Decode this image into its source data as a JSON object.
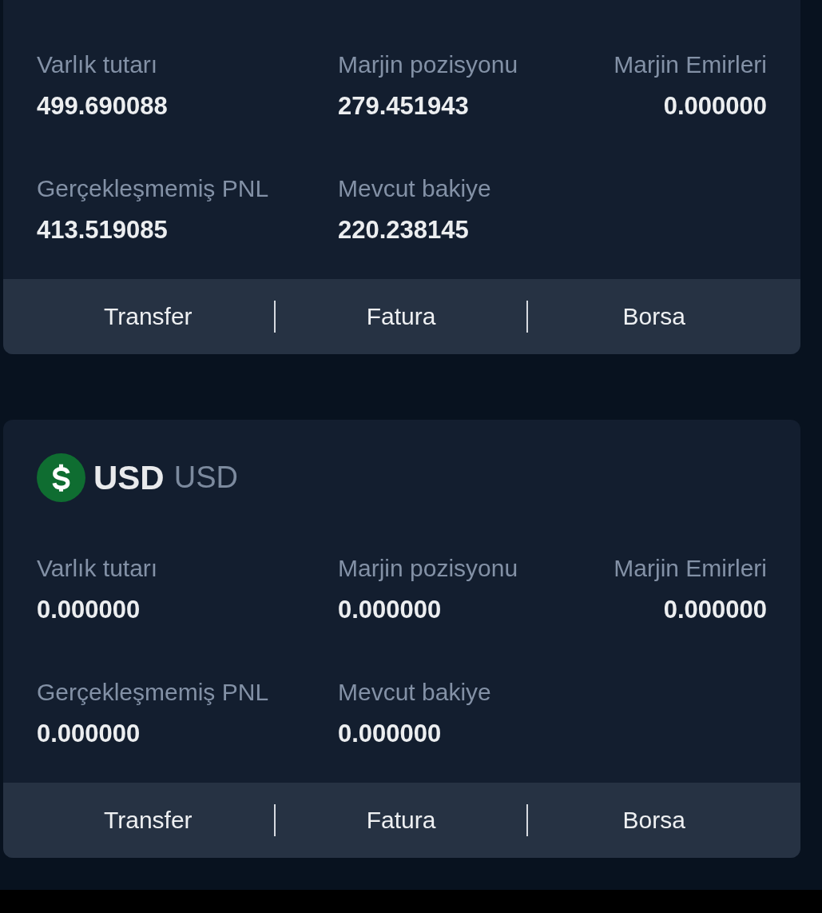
{
  "cards": [
    {
      "fields": [
        {
          "label": "Varlık tutarı",
          "value": "499.690088"
        },
        {
          "label": "Marjin pozisyonu",
          "value": "279.451943"
        },
        {
          "label": "Marjin Emirleri",
          "value": "0.000000"
        },
        {
          "label": "Gerçekleşmemiş PNL",
          "value": "413.519085"
        },
        {
          "label": "Mevcut bakiye",
          "value": "220.238145"
        }
      ],
      "actions": [
        "Transfer",
        "Fatura",
        "Borsa"
      ]
    },
    {
      "header": {
        "title": "USD",
        "subtitle": "USD"
      },
      "fields": [
        {
          "label": "Varlık tutarı",
          "value": "0.000000"
        },
        {
          "label": "Marjin pozisyonu",
          "value": "0.000000"
        },
        {
          "label": "Marjin Emirleri",
          "value": "0.000000"
        },
        {
          "label": "Gerçekleşmemiş PNL",
          "value": "0.000000"
        },
        {
          "label": "Mevcut bakiye",
          "value": "0.000000"
        }
      ],
      "actions": [
        "Transfer",
        "Fatura",
        "Borsa"
      ]
    }
  ]
}
